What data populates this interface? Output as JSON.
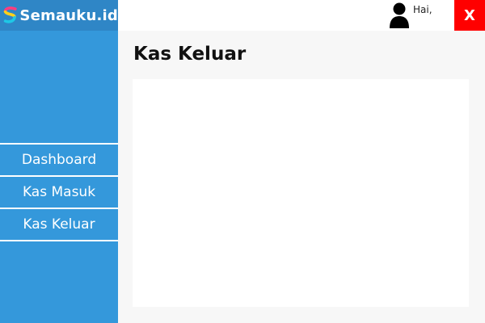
{
  "brand": {
    "name": "Semauku.id",
    "logo_icon": "semauku-s-logo-icon"
  },
  "header": {
    "greeting": "Hai,",
    "user_icon": "user-icon",
    "close_label": "X",
    "close_color": "#ff0000"
  },
  "sidebar": {
    "color": "#3498db",
    "items": [
      {
        "label": "Dashboard"
      },
      {
        "label": "Kas Masuk"
      },
      {
        "label": "Kas Keluar"
      }
    ]
  },
  "main": {
    "title": "Kas Keluar"
  }
}
